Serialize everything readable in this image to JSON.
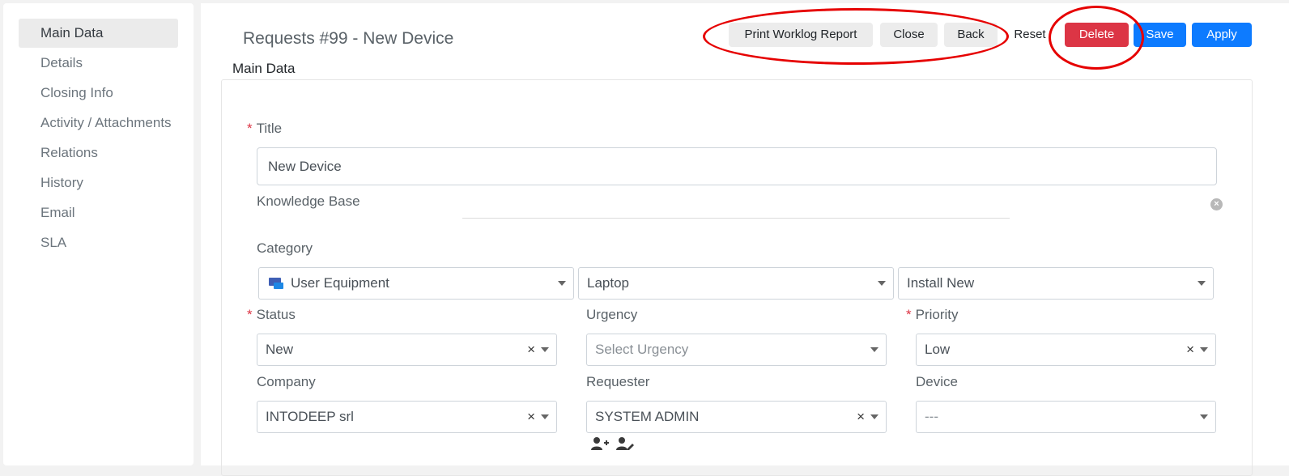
{
  "sidebar": {
    "items": [
      {
        "label": "Main Data"
      },
      {
        "label": "Details"
      },
      {
        "label": "Closing Info"
      },
      {
        "label": "Activity / Attachments"
      },
      {
        "label": "Relations"
      },
      {
        "label": "History"
      },
      {
        "label": "Email"
      },
      {
        "label": "SLA"
      }
    ]
  },
  "header": {
    "title": "Requests #99 - New Device",
    "section": "Main Data"
  },
  "toolbar": {
    "print_label": "Print Worklog Report",
    "close_label": "Close",
    "back_label": "Back",
    "reset_label": "Reset",
    "delete_label": "Delete",
    "save_label": "Save",
    "apply_label": "Apply"
  },
  "form": {
    "required_mark": "*",
    "title_label": "Title",
    "title_value": "New Device",
    "kb_label": "Knowledge Base",
    "category_label": "Category",
    "category_1": "User Equipment",
    "category_2": "Laptop",
    "category_3": "Install New",
    "status_label": "Status",
    "status_value": "New",
    "urgency_label": "Urgency",
    "urgency_placeholder": "Select Urgency",
    "priority_label": "Priority",
    "priority_value": "Low",
    "company_label": "Company",
    "company_value": "INTODEEP srl",
    "requester_label": "Requester",
    "requester_value": "SYSTEM ADMIN",
    "device_label": "Device",
    "device_value": "---",
    "clear_glyph": "×"
  },
  "colors": {
    "danger": "#dc3545",
    "primary": "#0d7bff",
    "annotation": "#e60000"
  }
}
